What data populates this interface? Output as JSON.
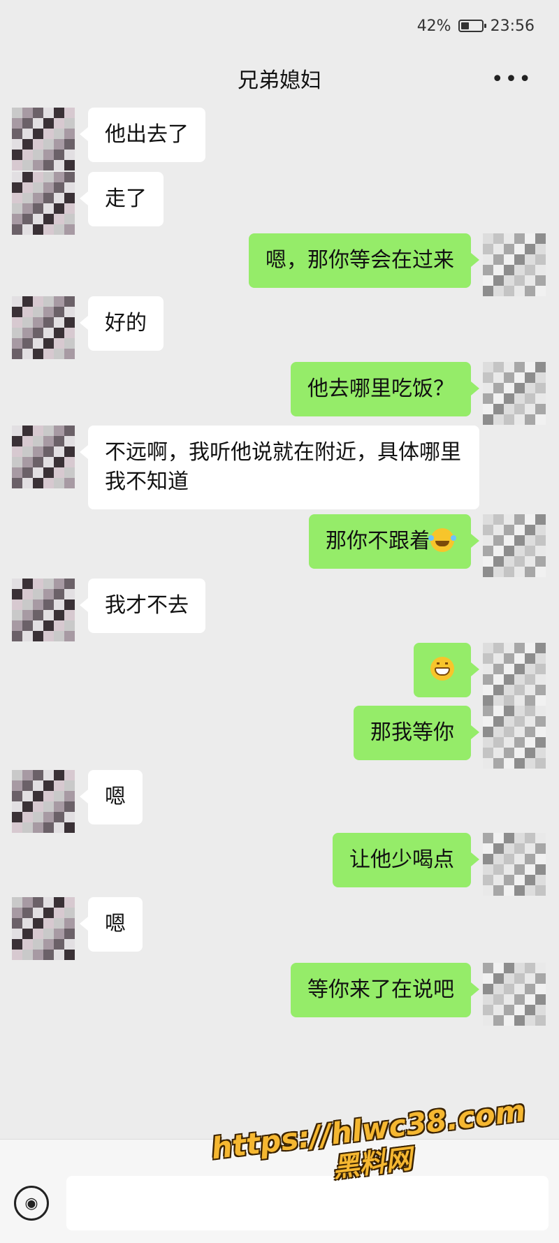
{
  "status_bar": {
    "battery": "42%",
    "time": "23:56",
    "battery_level": 0.42
  },
  "header": {
    "title": "兄弟媳妇",
    "more_icon": "more-dots-icon"
  },
  "messages": [
    {
      "side": "left",
      "text": "他出去了"
    },
    {
      "side": "left",
      "text": "走了"
    },
    {
      "side": "right",
      "text": "嗯，那你等会在过来"
    },
    {
      "side": "left",
      "text": "好的"
    },
    {
      "side": "right",
      "text": "他去哪里吃饭？"
    },
    {
      "side": "left",
      "text": "不远啊，我听他说就在附近，具体哪里我不知道"
    },
    {
      "side": "right",
      "text": "那你不跟着",
      "emoji": "laughing-tears-emoji"
    },
    {
      "side": "left",
      "text": "我才不去"
    },
    {
      "side": "right",
      "text": "",
      "emoji": "grinning-emoji"
    },
    {
      "side": "right",
      "text": "那我等你"
    },
    {
      "side": "left",
      "text": "嗯"
    },
    {
      "side": "right",
      "text": "让他少喝点"
    },
    {
      "side": "left",
      "text": "嗯"
    },
    {
      "side": "right",
      "text": "等你来了在说吧"
    }
  ],
  "input": {
    "value": "",
    "voice_icon": "voice-icon"
  },
  "watermark": {
    "url": "https://hlwc38.com",
    "name": "黑料网"
  },
  "colors": {
    "background": "#ececec",
    "bubble_self": "#95ec69",
    "bubble_other": "#ffffff",
    "watermark": "#f5b731"
  }
}
